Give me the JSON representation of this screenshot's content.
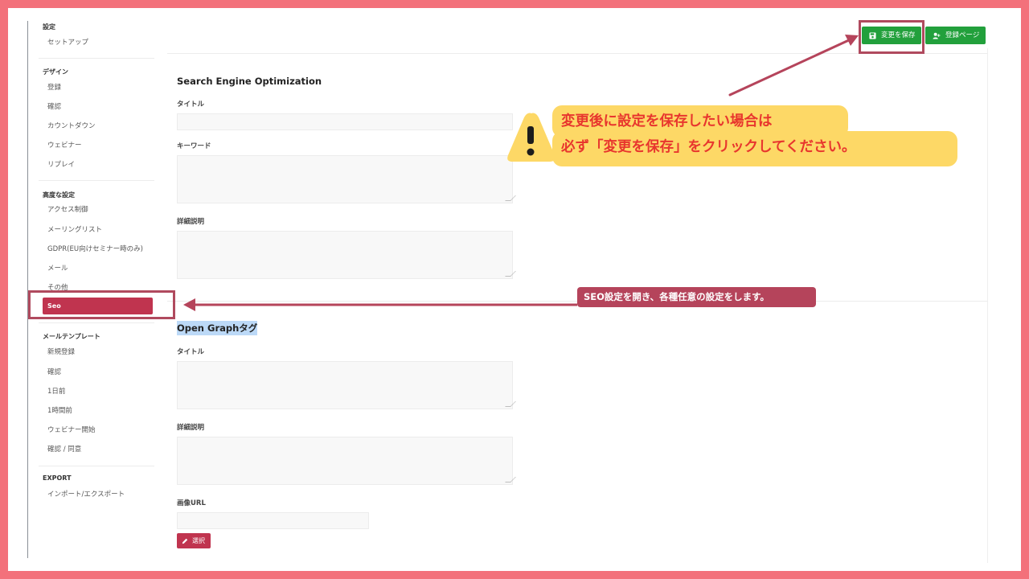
{
  "sidebar": {
    "sections": [
      {
        "title": "設定",
        "items": [
          "セットアップ"
        ]
      },
      {
        "title": "デザイン",
        "items": [
          "登録",
          "確認",
          "カウントダウン",
          "ウェビナー",
          "リプレイ"
        ]
      },
      {
        "title": "高度な設定",
        "items": [
          "アクセス制御",
          "メーリングリスト",
          "GDPR(EU向けセミナー時のみ)",
          "メール",
          "その他"
        ]
      },
      {
        "title": "メールテンプレート",
        "items": [
          "新規登録",
          "確認",
          "1日前",
          "1時間前",
          "ウェビナー開始",
          "確認 / 同意"
        ]
      },
      {
        "title": "EXPORT",
        "items": [
          "インポート/エクスポート"
        ]
      }
    ],
    "active_item": "Seo"
  },
  "toolbar": {
    "save_label": "変更を保存",
    "register_page_label": "登録ページ"
  },
  "seo": {
    "heading": "Search Engine Optimization",
    "title_label": "タイトル",
    "keywords_label": "キーワード",
    "description_label": "詳細説明"
  },
  "og": {
    "heading": "Open Graphタグ",
    "title_label": "タイトル",
    "description_label": "詳細説明",
    "image_label": "画像URL",
    "select_label": "選択"
  },
  "annotations": {
    "warning_line1": "変更後に設定を保存したい場合は",
    "warning_line2": "必ず「変更を保存」をクリックしてください。",
    "seo_note": "SEO設定を開き、各種任意の設定をします。"
  },
  "colors": {
    "page_border": "#f3717b",
    "primary_green": "#22a03c",
    "active_red": "#c0344f",
    "annotation": "#b5445b",
    "bubble_yellow": "#fdd866",
    "bubble_text": "#e8362e"
  }
}
